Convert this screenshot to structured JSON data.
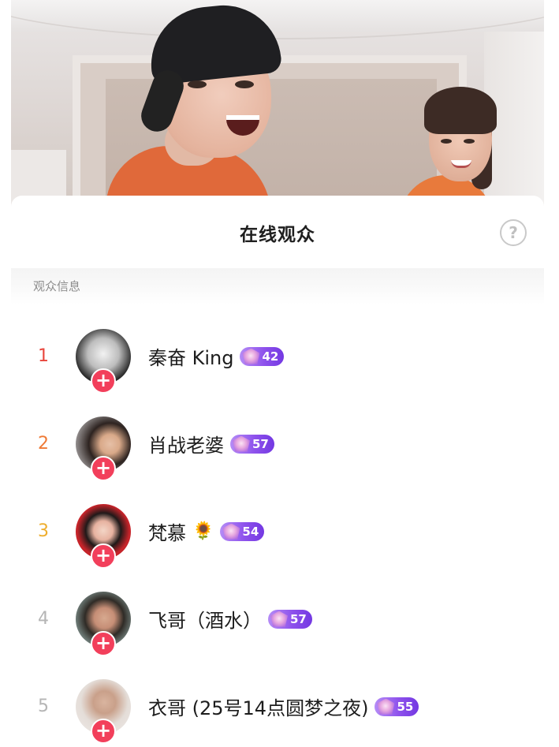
{
  "sheet": {
    "title": "在线观众",
    "help_icon": "?",
    "section_label": "观众信息"
  },
  "viewers": [
    {
      "rank": "1",
      "name": "秦奋 King",
      "level": "42",
      "emoji": ""
    },
    {
      "rank": "2",
      "name": "肖战老婆",
      "level": "57",
      "emoji": ""
    },
    {
      "rank": "3",
      "name": "梵慕",
      "level": "54",
      "emoji": "🌻"
    },
    {
      "rank": "4",
      "name": "飞哥（酒水）",
      "level": "57",
      "emoji": ""
    },
    {
      "rank": "5",
      "name": "衣哥 (25号14点圆梦之夜)",
      "level": "55",
      "emoji": ""
    }
  ],
  "follow_button": "+",
  "colors": {
    "rank_1": "#e8453c",
    "rank_2": "#ef7a36",
    "rank_3": "#eeae2e",
    "rank_other": "#b5b5b5",
    "follow_button": "#f23f5b",
    "level_badge": "#8e52ec"
  },
  "icons": {
    "help": "question-circle-icon",
    "follow": "plus-icon",
    "level": "gem-icon"
  }
}
